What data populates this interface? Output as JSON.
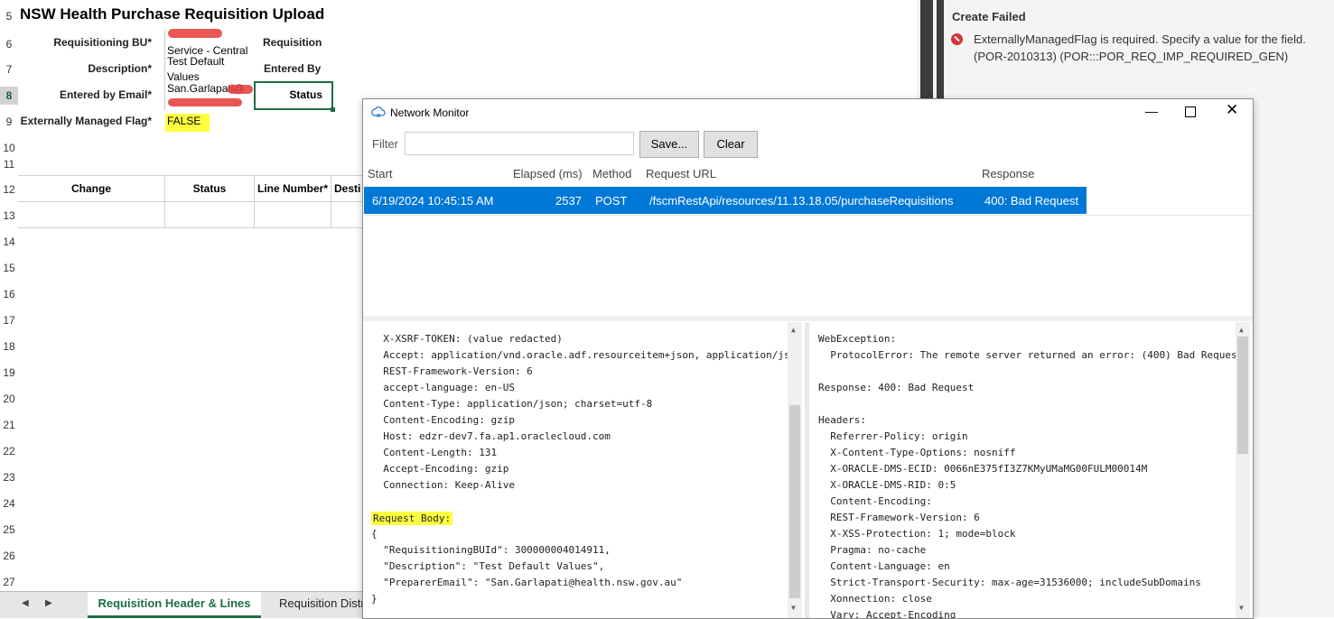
{
  "sheet": {
    "title": "NSW Health Purchase Requisition Upload",
    "rows": [
      "5",
      "6",
      "7",
      "8",
      "9",
      "10",
      "11",
      "12",
      "13",
      "14",
      "15",
      "16",
      "17",
      "18",
      "19",
      "20",
      "21",
      "22",
      "23",
      "24",
      "25",
      "26",
      "27"
    ],
    "labels": {
      "requisitioning_bu": "Requisitioning BU*",
      "description": "Description*",
      "entered_by_email": "Entered by Email*",
      "externally_managed_flag": "Externally Managed Flag*",
      "requisition": "Requisition",
      "entered_by": "Entered By",
      "status": "Status"
    },
    "values": {
      "requisitioning_bu": "Service - Central",
      "description_1": "Test Default",
      "description_2": "Values",
      "email": "San.Garlapati@",
      "flag": "FALSE"
    },
    "columns": [
      "Change",
      "Status",
      "Line Number*",
      "Desti"
    ],
    "tabs": [
      "Requisition Header & Lines",
      "Requisition Distr"
    ]
  },
  "error_panel": {
    "title": "Create Failed",
    "message_1": "ExternallyManagedFlag is required. Specify a value for the field.",
    "message_2": "(POR-2010313) (POR:::POR_REQ_IMP_REQUIRED_GEN)"
  },
  "network_monitor": {
    "title": "Network Monitor",
    "filter_label": "Filter",
    "filter_value": "",
    "save_label": "Save...",
    "clear_label": "Clear",
    "headers": [
      "Start",
      "Elapsed (ms)",
      "Method",
      "Request URL",
      "Response"
    ],
    "rows": [
      {
        "start": "6/19/2024 10:45:15 AM",
        "elapsed": "2537",
        "method": "POST",
        "url": "/fscmRestApi/resources/11.13.18.05/purchaseRequisitions",
        "response": "400: Bad Request"
      }
    ],
    "request_lines": [
      "  X-XSRF-TOKEN: (value redacted)",
      "  Accept: application/vnd.oracle.adf.resourceitem+json, application/js",
      "  REST-Framework-Version: 6",
      "  accept-language: en-US",
      "  Content-Type: application/json; charset=utf-8",
      "  Content-Encoding: gzip",
      "  Host: edzr-dev7.fa.ap1.oraclecloud.com",
      "  Content-Length: 131",
      "  Accept-Encoding: gzip",
      "  Connection: Keep-Alive",
      "",
      "Request Body:",
      "{",
      "  \"RequisitioningBUId\": 300000004014911,",
      "  \"Description\": \"Test Default Values\",",
      "  \"PreparerEmail\": \"San.Garlapati@health.nsw.gov.au\"",
      "}"
    ],
    "response_lines": [
      "WebException:",
      "  ProtocolError: The remote server returned an error: (400) Bad Reques",
      "",
      "Response: 400: Bad Request",
      "",
      "Headers:",
      "  Referrer-Policy: origin",
      "  X-Content-Type-Options: nosniff",
      "  X-ORACLE-DMS-ECID: 0066nE375fI3Z7KMyUMaMG00FULM00014M",
      "  X-ORACLE-DMS-RID: 0:5",
      "  Content-Encoding:",
      "  REST-Framework-Version: 6",
      "  X-XSS-Protection: 1; mode=block",
      "  Pragma: no-cache",
      "  Content-Language: en",
      "  Strict-Transport-Security: max-age=31536000; includeSubDomains",
      "  Xonnection: close",
      "  Vary: Accept-Encoding"
    ]
  },
  "colors": {
    "selection": "#0078d7",
    "highlight": "#ffff3f",
    "excel_green": "#1e6e42",
    "error_red": "#d13438"
  }
}
